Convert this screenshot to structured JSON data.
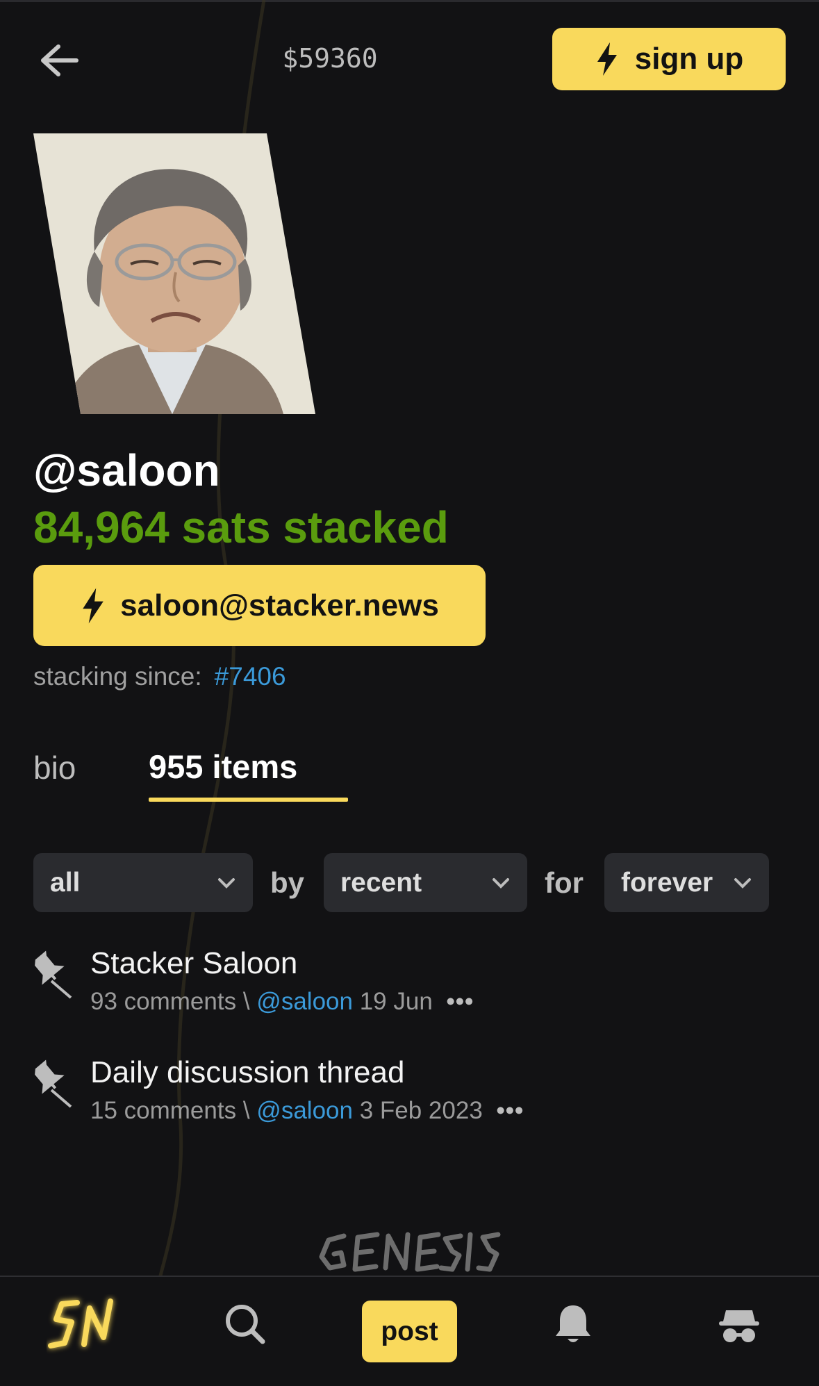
{
  "header": {
    "price": "$59360",
    "signup_label": "sign up"
  },
  "profile": {
    "handle": "@saloon",
    "sats_stacked": "84,964 sats stacked",
    "lightning_address": "saloon@stacker.news",
    "stacking_since_label": "stacking since:",
    "stacking_since_item": "#7406"
  },
  "tabs": [
    {
      "label": "bio",
      "active": false
    },
    {
      "label": "955 items",
      "active": true
    }
  ],
  "filters": {
    "type": "all",
    "by_label": "by",
    "sort": "recent",
    "for_label": "for",
    "when": "forever"
  },
  "items": [
    {
      "title": "Stacker Saloon",
      "comments": "93 comments",
      "separator": "\\",
      "user": "@saloon",
      "date": "19 Jun",
      "more": "•••",
      "pinned": true
    },
    {
      "title": "Daily discussion thread",
      "comments": "15 comments",
      "separator": "\\",
      "user": "@saloon",
      "date": "3 Feb 2023",
      "more": "•••",
      "pinned": true
    }
  ],
  "footer": {
    "logo_text": "GENESIS"
  },
  "bottom_nav": {
    "post_label": "post",
    "icons": [
      "sn-logo-icon",
      "search-icon",
      "post-button",
      "bell-icon",
      "anon-icon"
    ]
  },
  "colors": {
    "background": "#121214",
    "accent": "#f9d95c",
    "sats_green": "#5a9c0e",
    "link_blue": "#3b9ad9"
  }
}
